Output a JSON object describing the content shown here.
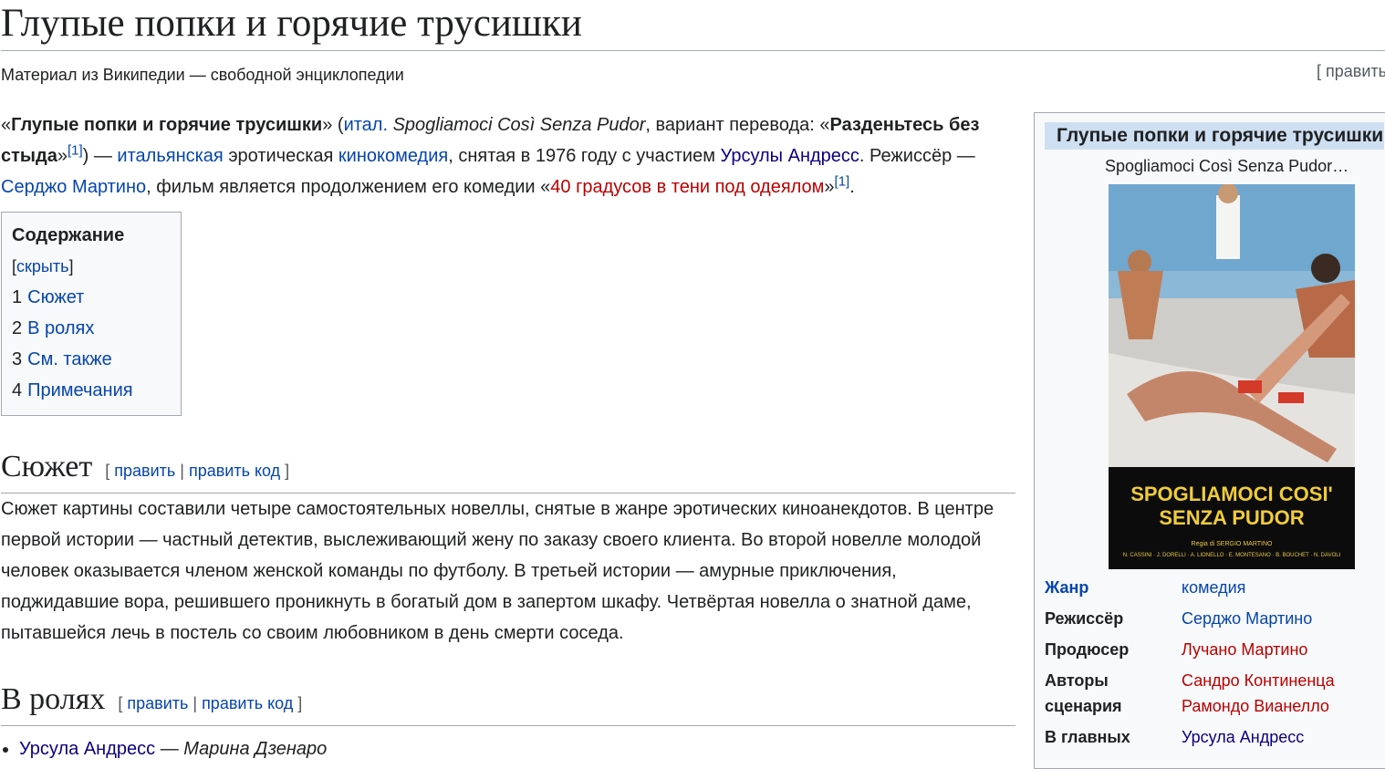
{
  "article": {
    "title": "Глупые попки и горячие трусишки",
    "tagline": "Материал из Википедии — свободной энциклопедии",
    "top_edit": "[ править"
  },
  "lead": {
    "q_open": "«",
    "name": "Глупые попки и горячие трусишки",
    "q_close_paren": "» (",
    "ital_link": "итал.",
    "orig_title": " Spogliamoci Così Senza Pudor",
    "variant_text": ", вариант перевода: «",
    "variant_name": "Разденьтесь без стыда",
    "q_close": "»",
    "ref": "[1]",
    "after_ref": ") — ",
    "link_italian": "итальянская",
    "text_erotic": " эротическая ",
    "link_comedy": "кинокомедия",
    "text_filmed": ", снятая в 1976 году с участием ",
    "link_andress": "Урсулы Андресс",
    "text_dot_director": ". Режиссёр — ",
    "link_martino": "Серджо Мартино",
    "text_continuation": ", фильм является продолжением его комедии «",
    "link_40": "40 градусов в тени под одеялом",
    "q_close2": "»",
    "ref2": "[1]",
    "end_dot": "."
  },
  "toc": {
    "title": "Содержание",
    "toggle_open": " [",
    "toggle": "скрыть",
    "toggle_close": "]",
    "items": [
      {
        "num": "1",
        "label": "Сюжет"
      },
      {
        "num": "2",
        "label": "В ролях"
      },
      {
        "num": "3",
        "label": "См. также"
      },
      {
        "num": "4",
        "label": "Примечания"
      }
    ]
  },
  "sections": {
    "plot": {
      "heading": "Сюжет",
      "edit_open": "[ ",
      "edit": "править",
      "edit_sep": " | ",
      "edit_code": "править код",
      "edit_close": " ]",
      "text": "Сюжет картины составили четыре самостоятельных новеллы, снятые в жанре эротических киноанекдотов. В центре первой истории — частный детектив, выслеживающий жену по заказу своего клиента. Во второй новелле молодой человек оказывается членом женской команды по футболу. В третьей истории — амурные приключения, поджидавшие вора, решившего проникнуть в богатый дом в запертом шкафу. Четвёртая новелла о знатной даме, пытавшейся лечь в постель со своим любовником в день смерти соседа."
    },
    "cast": {
      "heading": "В ролях",
      "edit_open": "[ ",
      "edit": "править",
      "edit_sep": " | ",
      "edit_code": "править код",
      "edit_close": " ]",
      "items": [
        {
          "actor": "Урсула Андресс",
          "dash": " — ",
          "role": "Марина Дзенаро"
        }
      ]
    }
  },
  "infobox": {
    "title": "Глупые попки и горячие трусишки",
    "caption": "Spogliamoci Così Senza Pudor…",
    "poster_title_1": "SPOGLIAMOCI COSI'",
    "poster_title_2": "SENZA PUDOR",
    "poster_credit": "Regia di SERGIO MARTINO",
    "poster_cast": "N. CASSINI · J. DORELLI · A. LIONELLO · E. MONTESANO · B. BOUCHET · N. DAVOLI",
    "rows": [
      {
        "label": "Жанр",
        "value": "комедия"
      },
      {
        "label": "Режиссёр",
        "value": "Серджо Мартино"
      },
      {
        "label": "Продюсер",
        "value": "Лучано Мартино"
      },
      {
        "label": "Авторы сценария",
        "value": "Сандро Континенца",
        "value2": "Рамондо Вианелло"
      },
      {
        "label": "В главных",
        "value": "Урсула Андресс"
      }
    ]
  }
}
